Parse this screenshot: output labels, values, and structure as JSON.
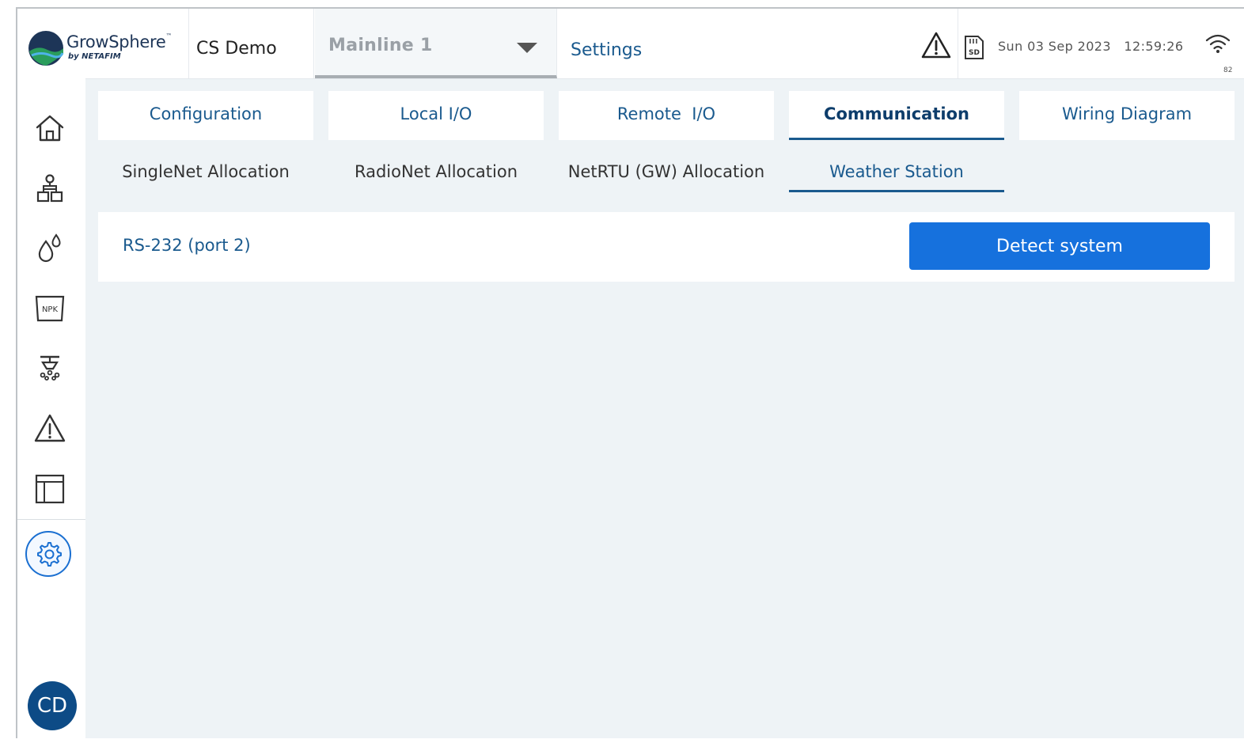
{
  "header": {
    "logo": {
      "name": "GrowSphere",
      "trademark": "™",
      "by": "by NETAFIM",
      "icon": "growsphere-globe-logo"
    },
    "site_name": "CS Demo",
    "mainline": {
      "selected": "Mainline 1",
      "icon": "caret-down-icon"
    },
    "page_title": "Settings",
    "date": "Sun 03 Sep 2023",
    "time": "12:59:26",
    "wifi_value": "82",
    "icons": [
      "alert-icon",
      "sd-card-icon",
      "wifi-icon"
    ]
  },
  "sidebar": {
    "items": [
      {
        "name": "home",
        "icon": "home-icon"
      },
      {
        "name": "network",
        "icon": "hierarchy-icon"
      },
      {
        "name": "water",
        "icon": "drops-icon"
      },
      {
        "name": "fertilizer",
        "icon": "npk-icon",
        "text": "NPK"
      },
      {
        "name": "irrigation",
        "icon": "sprinkler-icon"
      },
      {
        "name": "alarms",
        "icon": "alert-icon"
      },
      {
        "name": "reports",
        "icon": "table-icon"
      },
      {
        "name": "settings",
        "icon": "gear-icon",
        "active": true
      }
    ],
    "avatar": "CD"
  },
  "tabs": [
    {
      "label": "Configuration",
      "active": false
    },
    {
      "label": "Local I/O",
      "active": false
    },
    {
      "label": "Remote  I/O",
      "active": false
    },
    {
      "label": "Communication",
      "active": true
    },
    {
      "label": "Wiring Diagram",
      "active": false
    }
  ],
  "subtabs": [
    {
      "label": "SingleNet Allocation",
      "active": false
    },
    {
      "label": "RadioNet Allocation",
      "active": false
    },
    {
      "label": "NetRTU (GW) Allocation",
      "active": false
    },
    {
      "label": "Weather Station",
      "active": true
    }
  ],
  "content": {
    "port_label": "RS-232 (port 2)",
    "detect_button": "Detect system"
  },
  "colors": {
    "primary": "#1671dd",
    "text_blue": "#1a5a8e",
    "background": "#eef3f6",
    "avatar": "#0d4b86"
  }
}
